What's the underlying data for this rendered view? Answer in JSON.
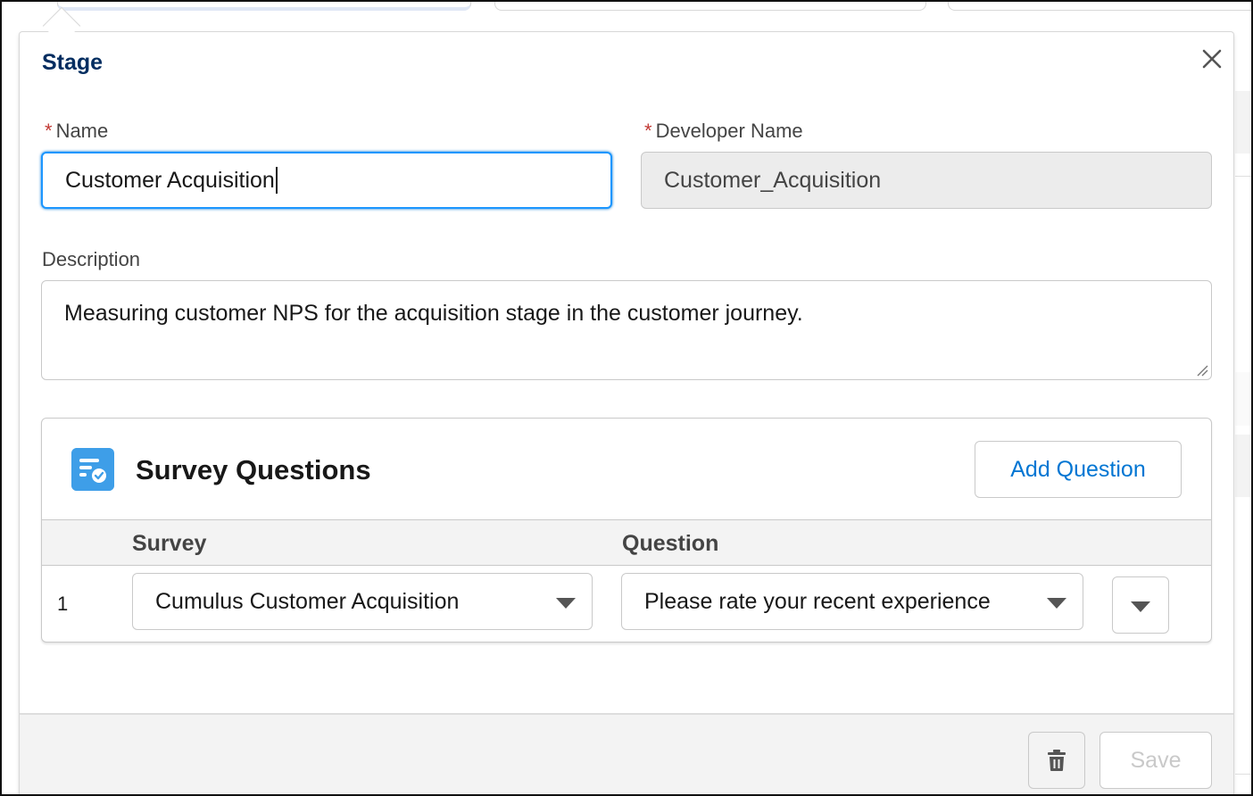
{
  "popover": {
    "title": "Stage",
    "close_icon": "close-icon"
  },
  "form": {
    "name_label": "Name",
    "name_value": "Customer Acquisition",
    "developer_name_label": "Developer Name",
    "developer_name_value": "Customer_Acquisition",
    "required_marker": "*",
    "description_label": "Description",
    "description_value": "Measuring customer NPS for the acquisition stage in the customer journey."
  },
  "survey_questions": {
    "icon": "survey-icon",
    "title": "Survey Questions",
    "add_button_label": "Add Question",
    "columns": [
      "Survey",
      "Question"
    ],
    "rows": [
      {
        "number": "1",
        "survey": "Cumulus Customer Acquisition",
        "question": "Please rate your recent experience"
      }
    ]
  },
  "footer": {
    "delete_icon": "trash-icon",
    "save_label": "Save"
  },
  "colors": {
    "title": "#032d60",
    "focus_border": "#1b96ff",
    "link_blue": "#0176d3",
    "required_red": "#c23934",
    "survey_icon_bg": "#3e9ee8",
    "disabled_text": "#c9c9c9"
  }
}
